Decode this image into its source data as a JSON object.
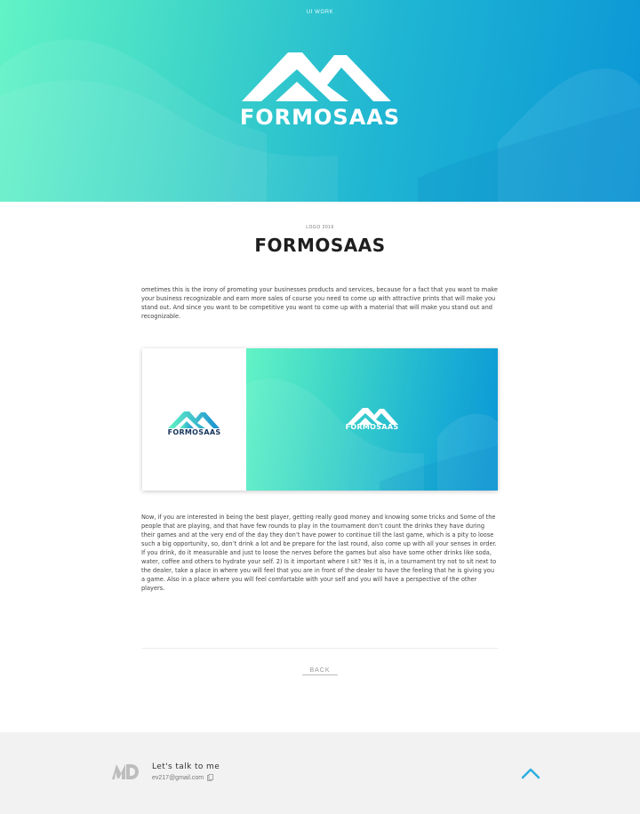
{
  "hero": {
    "nav_label": "UI WORK",
    "logo_icon": "formosaas-mountain-logo",
    "logo_text": "FORMOSAAS"
  },
  "content": {
    "kicker": "LOGO 2016",
    "title": "FORMOSAAS",
    "paragraph_1": "ometimes this is the irony of promoting your businesses products and services, because for a fact that you want to make your business recognizable and earn more sales of course you need to come up with attractive prints that will make you stand out. And since you want to be competitive you want to come up with a material that will make you stand out and recognizable.",
    "showcase": {
      "left_logo_text": "FORMOSAAS",
      "right_logo_text": "FORMOSAAS"
    },
    "paragraph_2": "Now, if you are interested in being the best player, getting really good money and knowing some tricks and Some of the people that are playing, and that have few rounds to play in the tournament don’t count the drinks they have during their games and at the very end of the day they don’t have power to continue till the last game, which is a pity to loose such a big opportunity, so, don’t drink a lot and be prepare for the last round, also come up with all your senses in order. If you drink, do it measurable and just to loose the nerves before the games but also have some other drinks like soda, water, coffee and others to hydrate your self. 2) Is it important where I sit? Yes it is, in a tournament try not to sit next to the dealer, take a place in where you will feel that you are in front of the dealer to have the feeling that he is giving you a game. Also in a place where you will feel comfortable with your self and you will have a perspective of the other players.",
    "back_label": "BACK"
  },
  "footer": {
    "logo_icon": "md-monogram-icon",
    "talk_label": "Let's talk to me",
    "email": "ev217@gmail.com",
    "copy_icon": "copy-icon",
    "top_icon": "chevron-up-icon"
  },
  "colors": {
    "gradient_start": "#62f3c5",
    "gradient_end": "#0b96d6",
    "accent": "#1fb5d3",
    "footer_bg": "#f2f2f2",
    "logo_dark": "#16355c"
  }
}
